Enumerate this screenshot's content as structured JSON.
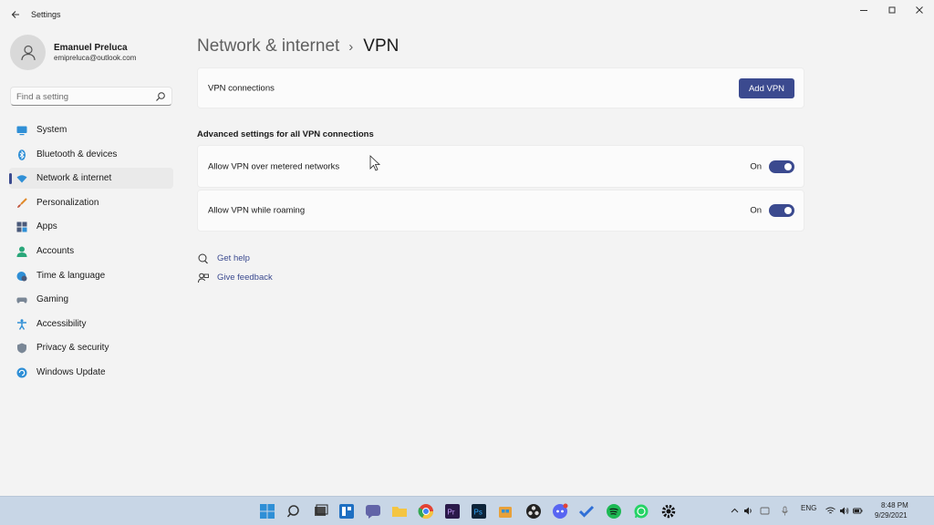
{
  "window": {
    "title": "Settings"
  },
  "profile": {
    "name": "Emanuel Preluca",
    "email": "emipreluca@outlook.com"
  },
  "search": {
    "placeholder": "Find a setting",
    "value": ""
  },
  "sidebar": {
    "items": [
      {
        "label": "System",
        "icon": "monitor-icon",
        "active": false
      },
      {
        "label": "Bluetooth & devices",
        "icon": "bluetooth-icon",
        "active": false
      },
      {
        "label": "Network & internet",
        "icon": "wifi-icon",
        "active": true
      },
      {
        "label": "Personalization",
        "icon": "brush-icon",
        "active": false
      },
      {
        "label": "Apps",
        "icon": "apps-icon",
        "active": false
      },
      {
        "label": "Accounts",
        "icon": "person-icon",
        "active": false
      },
      {
        "label": "Time & language",
        "icon": "globe-clock-icon",
        "active": false
      },
      {
        "label": "Gaming",
        "icon": "gamepad-icon",
        "active": false
      },
      {
        "label": "Accessibility",
        "icon": "accessibility-icon",
        "active": false
      },
      {
        "label": "Privacy & security",
        "icon": "shield-icon",
        "active": false
      },
      {
        "label": "Windows Update",
        "icon": "update-icon",
        "active": false
      }
    ]
  },
  "breadcrumb": {
    "parent": "Network & internet",
    "separator": "›",
    "current": "VPN"
  },
  "vpn_connections": {
    "label": "VPN connections",
    "add_button": "Add VPN"
  },
  "advanced": {
    "title": "Advanced settings for all VPN connections",
    "settings": [
      {
        "label": "Allow VPN over metered networks",
        "state": "On",
        "enabled": true
      },
      {
        "label": "Allow VPN while roaming",
        "state": "On",
        "enabled": true
      }
    ]
  },
  "links": {
    "help": "Get help",
    "feedback": "Give feedback"
  },
  "taskbar": {
    "apps": [
      "start-icon",
      "search-icon",
      "task-view-icon",
      "widgets-icon",
      "teams-chat-icon",
      "file-explorer-icon",
      "chrome-icon",
      "premiere-icon",
      "photoshop-icon",
      "store-icon",
      "obs-icon",
      "discord-icon",
      "todo-icon",
      "spotify-icon",
      "whatsapp-icon",
      "settings-gear-icon"
    ],
    "tray": {
      "language": "ENG",
      "time": "8:48 PM",
      "date": "9/29/2021"
    }
  },
  "colors": {
    "accent": "#3b4a8f",
    "background": "#f3f3f3",
    "card": "#fbfbfb",
    "taskbar": "#c8d6e6"
  }
}
